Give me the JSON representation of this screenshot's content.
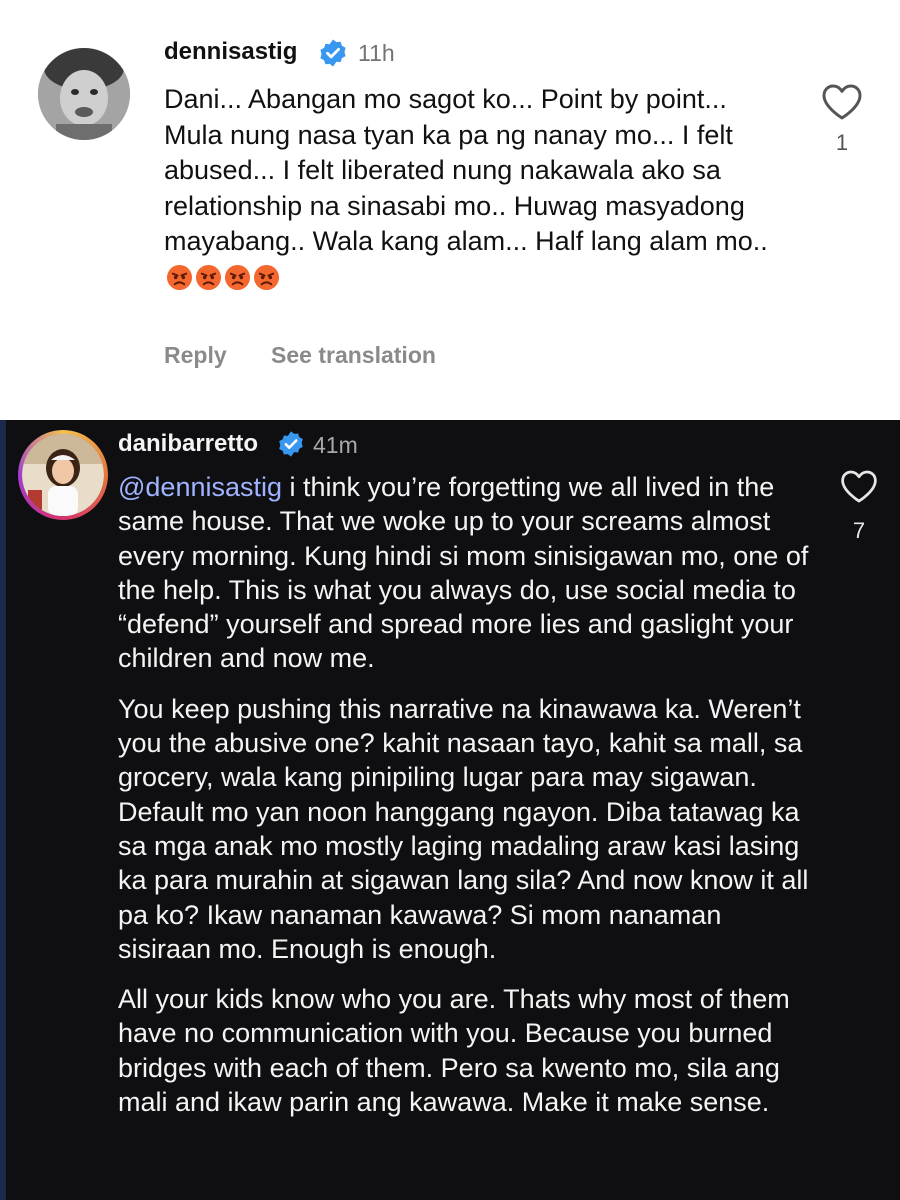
{
  "comments": [
    {
      "username": "dennisastig",
      "verified": true,
      "time": "11h",
      "text": "Dani... Abangan mo sagot ko... Point by point... Mula nung nasa tyan ka pa ng nanay mo... I felt abused... I felt liberated nung nakawala ako sa relationship na sinasabi mo.. Huwag masyadong mayabang.. Wala kang alam... Half lang alam mo..",
      "emojis": [
        "angry-face",
        "angry-face",
        "angry-face",
        "angry-face"
      ],
      "likes": "1",
      "reply_label": "Reply",
      "translate_label": "See translation",
      "theme": "light"
    },
    {
      "username": "danibarretto",
      "verified": true,
      "time": "41m",
      "mention": "@dennisastig",
      "paragraphs": [
        " i think you’re forgetting we all lived in the same house. That we woke up to your screams almost every morning. Kung hindi si mom sinisigawan mo, one of the help. This is what you always do, use social media to “defend” yourself and spread more lies and gaslight your children and now me.",
        "You keep pushing this narrative na kinawawa ka. Weren’t you the abusive one? kahit nasaan tayo, kahit sa mall, sa grocery, wala kang pinipiling lugar para may sigawan. Default mo yan noon hanggang ngayon. Diba tatawag ka sa mga anak mo mostly laging madaling araw kasi lasing ka para murahin at sigawan lang sila? And now know it all pa ko? Ikaw nanaman kawawa? Si mom nanaman sisiraan mo. Enough is enough.",
        "All your kids know who you are. Thats why most of them have no communication with you. Because you burned bridges with each of them. Pero sa kwento mo, sila ang mali and ikaw parin ang kawawa. Make it make sense."
      ],
      "likes": "7",
      "theme": "dark"
    }
  ],
  "colors": {
    "verified_badge": "#3897f0",
    "mention_link": "#9fb3ff",
    "dark_background": "#0f0f12",
    "light_secondary_text": "#8a8a8a"
  },
  "icons": {
    "like": "heart-outline-icon",
    "verified": "verified-badge-icon",
    "emoji": "angry-face-emoji"
  }
}
